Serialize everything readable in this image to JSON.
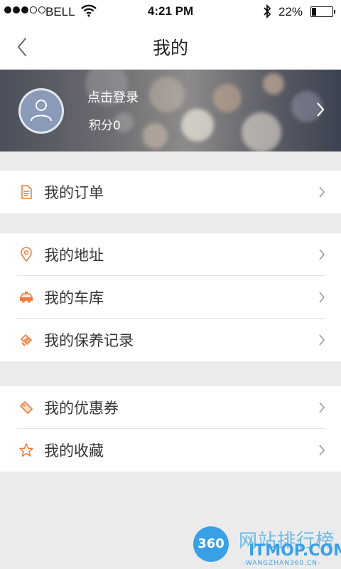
{
  "status_bar": {
    "carrier": "BELL",
    "time": "4:21 PM",
    "battery_percent": "22%",
    "battery_level": 0.22
  },
  "navbar": {
    "title": "我的"
  },
  "profile": {
    "login_label": "点击登录",
    "points_label": "积分0"
  },
  "menu_groups": [
    [
      {
        "label": "我的订单",
        "icon": "document-icon"
      }
    ],
    [
      {
        "label": "我的地址",
        "icon": "location-pin-icon"
      },
      {
        "label": "我的车库",
        "icon": "car-icon"
      },
      {
        "label": "我的保养记录",
        "icon": "wrench-icon"
      }
    ],
    [
      {
        "label": "我的优惠券",
        "icon": "coupon-tag-icon"
      },
      {
        "label": "我的收藏",
        "icon": "star-icon"
      }
    ]
  ],
  "colors": {
    "accent": "#f07c3a",
    "background": "#ebebeb",
    "watermark": "#3aa0e6"
  },
  "watermark": {
    "logo_text": "360",
    "title": "网站排行榜",
    "site": "ITMOP.COM",
    "subtitle": "-WANGZHAN360.CN-"
  }
}
